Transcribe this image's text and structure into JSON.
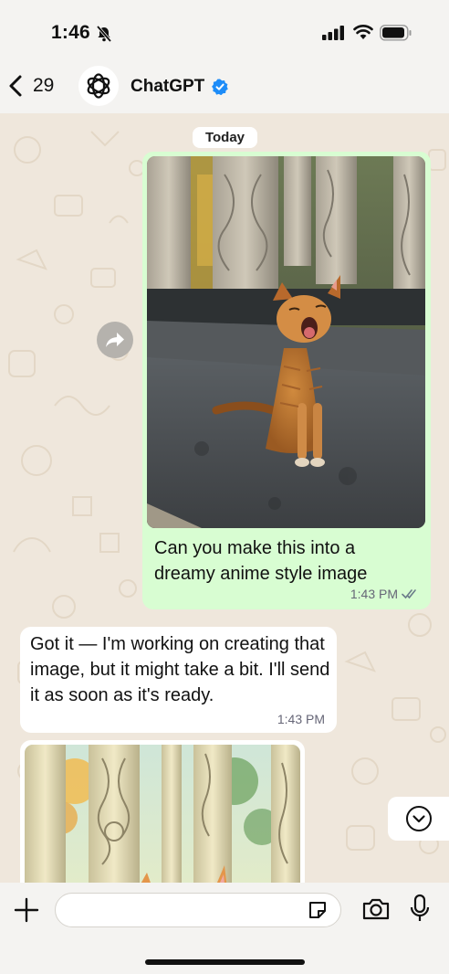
{
  "status_bar": {
    "time": "1:46"
  },
  "header": {
    "back_count": "29",
    "contact_name": "ChatGPT"
  },
  "date_separator": "Today",
  "messages": [
    {
      "direction": "outgoing",
      "type": "image_with_caption",
      "image_desc": "orange-tabby-cat-yawning-photo",
      "caption": "Can you make this into a dreamy anime style image",
      "time": "1:43 PM",
      "status": "read"
    },
    {
      "direction": "incoming",
      "type": "text",
      "text": "Got it — I'm working on creating that image, but it might take a bit. I'll send it as soon as it's ready.",
      "time": "1:43 PM"
    },
    {
      "direction": "incoming",
      "type": "image",
      "image_desc": "anime-style-cat-illustration"
    }
  ],
  "composer": {
    "placeholder": ""
  },
  "colors": {
    "outgoing_bubble": "#d8fdd2",
    "incoming_bubble": "#ffffff",
    "verified": "#1d8cf8",
    "wallpaper": "#efe7dc"
  }
}
